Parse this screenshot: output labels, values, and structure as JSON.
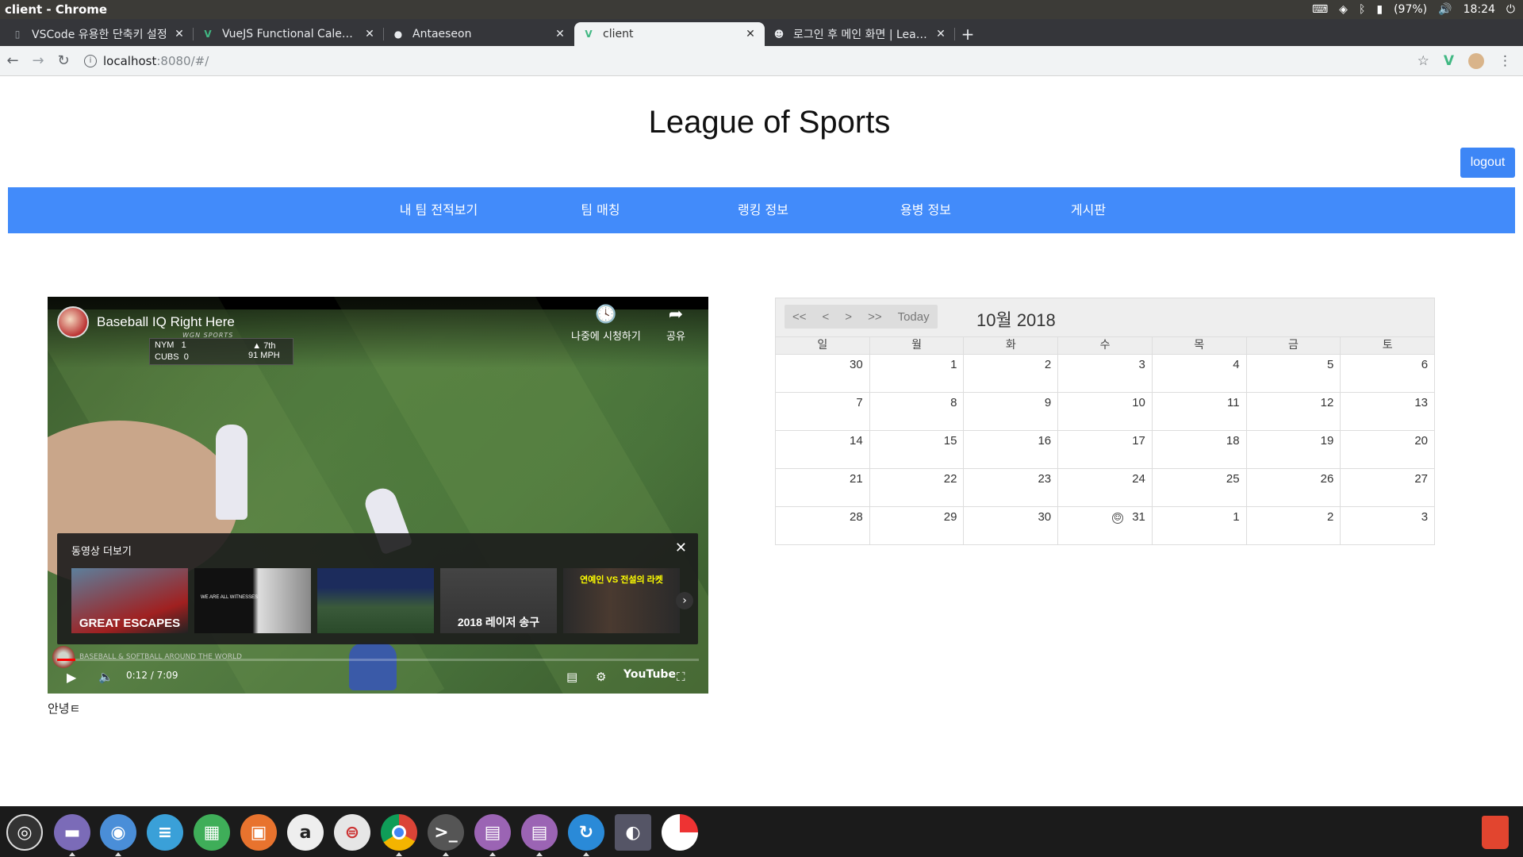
{
  "os": {
    "window_title": "client - Chrome",
    "battery": "(97%)",
    "clock": "18:24"
  },
  "browser": {
    "tabs": [
      {
        "title": "VSCode 유용한 단축키 설정",
        "favicon": "doc-icon"
      },
      {
        "title": "VueJS Functional Calendar",
        "favicon": "vue-icon"
      },
      {
        "title": "Antaeseon",
        "favicon": "github-icon"
      },
      {
        "title": "client",
        "favicon": "vue-icon"
      },
      {
        "title": "로그인 후 메인 화면 | League",
        "favicon": "smile-icon"
      }
    ],
    "url_host": "localhost",
    "url_path": ":8080/#/"
  },
  "site": {
    "title": "League of Sports",
    "logout_label": "logout",
    "nav": [
      "내 팀 전적보기",
      "팀 매칭",
      "랭킹 정보",
      "용병 정보",
      "게시판"
    ],
    "greeting": "안녕ㅌ"
  },
  "video": {
    "title": "Baseball IQ Right Here",
    "watch_later": "나중에 시청하기",
    "share": "공유",
    "more_videos": "동영상 더보기",
    "time": "0:12 / 7:09",
    "progress": 0.028,
    "youtube_logo": "YouTube",
    "scorebug": {
      "team1": "NYM",
      "score1": "1",
      "team2": "CUBS",
      "score2": "0",
      "inning": "▲ 7th",
      "pitch": "91 MPH",
      "network": "WGN SPORTS"
    },
    "watermark": "BASEBALL & SOFTBALL AROUND THE WORLD",
    "thumbnails": [
      {
        "caption": "GREAT ESCAPES"
      },
      {
        "caption": "WE ARE ALL WITNESSES"
      },
      {
        "caption": ""
      },
      {
        "caption": "2018 레이저 송구"
      },
      {
        "caption": "연예인 VS 전설의 라켓"
      }
    ]
  },
  "calendar": {
    "nav_buttons": [
      "<<",
      "<",
      ">",
      ">>",
      "Today"
    ],
    "title": "10월 2018",
    "weekdays": [
      "일",
      "월",
      "화",
      "수",
      "목",
      "금",
      "토"
    ],
    "weeks": [
      [
        "30",
        "1",
        "2",
        "3",
        "4",
        "5",
        "6"
      ],
      [
        "7",
        "8",
        "9",
        "10",
        "11",
        "12",
        "13"
      ],
      [
        "14",
        "15",
        "16",
        "17",
        "18",
        "19",
        "20"
      ],
      [
        "21",
        "22",
        "23",
        "24",
        "25",
        "26",
        "27"
      ],
      [
        "28",
        "29",
        "30",
        "31",
        "1",
        "2",
        "3"
      ]
    ],
    "event_day": "31"
  },
  "dock": {
    "apps": [
      "ubuntu-dash-icon",
      "files-icon",
      "firefox-icon",
      "libreoffice-writer-icon",
      "libreoffice-calc-icon",
      "libreoffice-impress-icon",
      "amazon-icon",
      "settings-icon",
      "chrome-icon",
      "terminal-icon",
      "text-editor-icon",
      "text-editor-icon",
      "software-updater-icon",
      "vpn-icon",
      "disk-usage-icon",
      "trash-icon"
    ]
  }
}
